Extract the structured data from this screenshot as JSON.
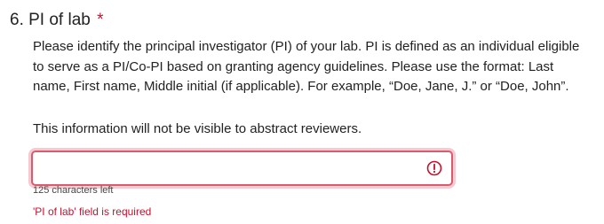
{
  "question": {
    "title": "6. PI of lab",
    "required_marker": "*",
    "description": "Please identify the principal investigator (PI) of your lab. PI is defined as an individual eligible to serve as a PI/Co-PI based on granting agency guidelines. Please use the format: Last name, First name, Middle initial (if applicable). For example, “Doe, Jane, J.” or “Doe, John”.",
    "note": "This information will not be visible to abstract reviewers.",
    "input": {
      "value": "",
      "placeholder": ""
    },
    "error_icon": "exclamation-circle-icon",
    "char_count": "125 characters left",
    "error_message": "'PI of lab' field is required"
  },
  "colors": {
    "error": "#c8102e",
    "input_border": "#d65c6e",
    "focus_ring": "#f7c9d1",
    "text": "#222222"
  }
}
